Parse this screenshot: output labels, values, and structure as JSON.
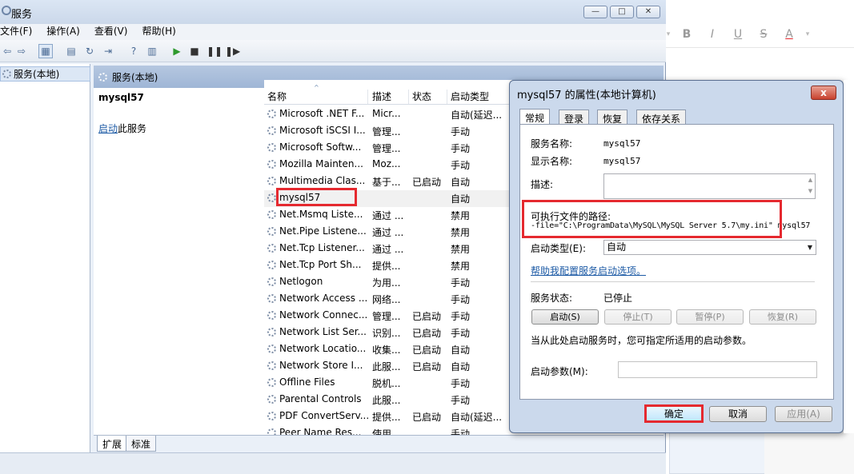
{
  "window": {
    "title": "服务"
  },
  "menu": [
    "文件(F)",
    "操作(A)",
    "查看(V)",
    "帮助(H)"
  ],
  "tree": {
    "item": "服务(本地)"
  },
  "pane": {
    "header": "服务(本地)",
    "selected_title": "mysql57",
    "start_link": "启动",
    "start_rest": "此服务"
  },
  "columns": {
    "name": "名称",
    "desc": "描述",
    "status": "状态",
    "type": "启动类型"
  },
  "services": [
    {
      "name": "Microsoft .NET F...",
      "desc": "Micr...",
      "status": "",
      "type": "自动(延迟..."
    },
    {
      "name": "Microsoft iSCSI I...",
      "desc": "管理...",
      "status": "",
      "type": "手动"
    },
    {
      "name": "Microsoft Softw...",
      "desc": "管理...",
      "status": "",
      "type": "手动"
    },
    {
      "name": "Mozilla Mainten...",
      "desc": "Moz...",
      "status": "",
      "type": "手动"
    },
    {
      "name": "Multimedia Clas...",
      "desc": "基于...",
      "status": "已启动",
      "type": "自动"
    },
    {
      "name": "mysql57",
      "desc": "",
      "status": "",
      "type": "自动"
    },
    {
      "name": "Net.Msmq Liste...",
      "desc": "通过 ...",
      "status": "",
      "type": "禁用"
    },
    {
      "name": "Net.Pipe Listene...",
      "desc": "通过 ...",
      "status": "",
      "type": "禁用"
    },
    {
      "name": "Net.Tcp Listener...",
      "desc": "通过 ...",
      "status": "",
      "type": "禁用"
    },
    {
      "name": "Net.Tcp Port Sh...",
      "desc": "提供...",
      "status": "",
      "type": "禁用"
    },
    {
      "name": "Netlogon",
      "desc": "为用...",
      "status": "",
      "type": "手动"
    },
    {
      "name": "Network Access ...",
      "desc": "网络...",
      "status": "",
      "type": "手动"
    },
    {
      "name": "Network Connec...",
      "desc": "管理...",
      "status": "已启动",
      "type": "手动"
    },
    {
      "name": "Network List Ser...",
      "desc": "识别...",
      "status": "已启动",
      "type": "手动"
    },
    {
      "name": "Network Locatio...",
      "desc": "收集...",
      "status": "已启动",
      "type": "自动"
    },
    {
      "name": "Network Store I...",
      "desc": "此服...",
      "status": "已启动",
      "type": "自动"
    },
    {
      "name": "Offline Files",
      "desc": "脱机...",
      "status": "",
      "type": "手动"
    },
    {
      "name": "Parental Controls",
      "desc": "此服...",
      "status": "",
      "type": "手动"
    },
    {
      "name": "PDF ConvertServ...",
      "desc": "提供...",
      "status": "已启动",
      "type": "自动(延迟..."
    },
    {
      "name": "Peer Name Res...",
      "desc": "使用...",
      "status": "",
      "type": "手动"
    }
  ],
  "bottom_tabs": [
    "扩展",
    "标准"
  ],
  "dialog": {
    "title": "mysql57 的属性(本地计算机)",
    "close": "x",
    "tabs": [
      "常规",
      "登录",
      "恢复",
      "依存关系"
    ],
    "service_name_label": "服务名称:",
    "service_name": "mysql57",
    "display_name_label": "显示名称:",
    "display_name": "mysql57",
    "desc_label": "描述:",
    "path_label": "可执行文件的路径:",
    "path_value": "-file=\"C:\\ProgramData\\MySQL\\MySQL Server 5.7\\my.ini\" mysql57",
    "starttype_label": "启动类型(E):",
    "starttype_value": "自动",
    "help_link": "帮助我配置服务启动选项。",
    "status_label": "服务状态:",
    "status_value": "已停止",
    "buttons": [
      "启动(S)",
      "停止(T)",
      "暂停(P)",
      "恢复(R)"
    ],
    "hint": "当从此处启动服务时，您可指定所适用的启动参数。",
    "param_label": "启动参数(M):",
    "ok": "确定",
    "cancel": "取消",
    "apply": "应用(A)"
  },
  "editor_toolbar": [
    "B",
    "I",
    "U",
    "S",
    "A"
  ]
}
